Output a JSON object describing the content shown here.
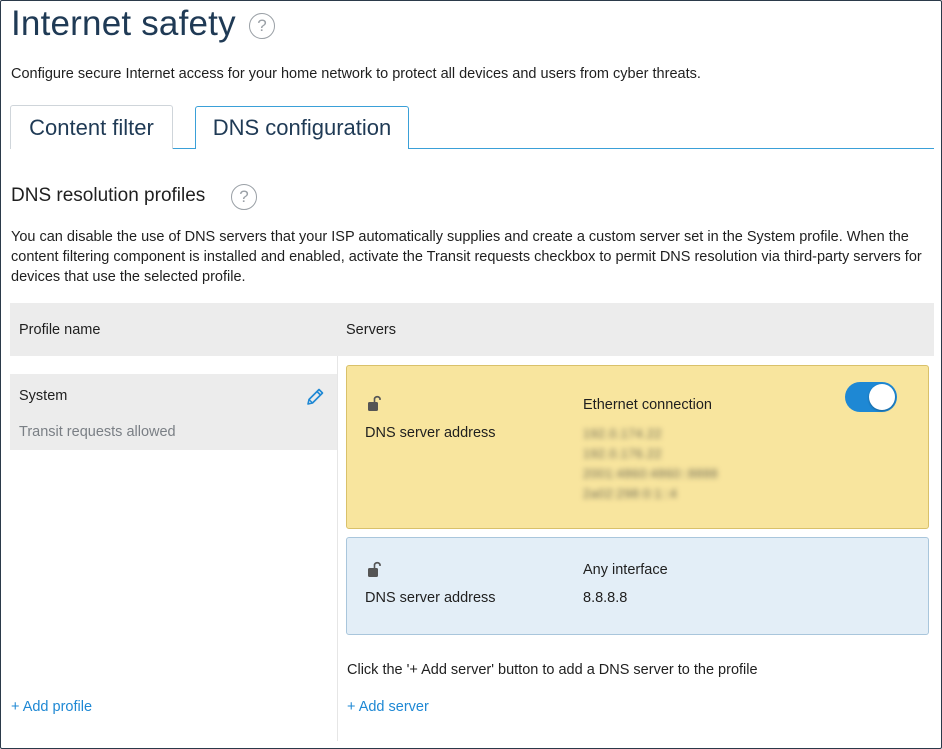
{
  "header": {
    "title": "Internet safety",
    "help_glyph": "?",
    "subtitle": "Configure secure Internet access for your home network to protect all devices and users from cyber threats."
  },
  "tabs": [
    {
      "label": "Content filter",
      "active": false
    },
    {
      "label": "DNS configuration",
      "active": true
    }
  ],
  "section": {
    "title": "DNS resolution profiles",
    "help_glyph": "?",
    "description": "You can disable the use of DNS servers that your ISP automatically supplies and create a custom server set in the System profile. When the content filtering component is installed and enabled, activate the Transit requests checkbox to permit DNS resolution via third-party servers for devices that use the selected profile."
  },
  "table": {
    "col_profile": "Profile name",
    "col_servers": "Servers"
  },
  "profile": {
    "name": "System",
    "status": "Transit requests allowed",
    "edit_icon": "pencil-icon"
  },
  "server_cards": [
    {
      "interface": "Ethernet connection",
      "label": "DNS server address",
      "addresses": [
        "192.0.174.22",
        "192.0.176.22",
        "2001:4860:4860::8888",
        "2a02:298:0:1::4"
      ],
      "addresses_obscured": true,
      "toggle_on": true,
      "lock_icon": "unlock-icon",
      "bg_color": "#f8e59e"
    },
    {
      "interface": "Any interface",
      "label": "DNS server address",
      "address": "8.8.8.8",
      "lock_icon": "unlock-icon",
      "bg_color": "#e3eef7"
    }
  ],
  "hint": "Click the '+ Add server' button to add a DNS server to the profile",
  "actions": {
    "add_profile": "+ Add profile",
    "add_server": "+ Add server"
  },
  "colors": {
    "accent": "#1e88d4",
    "title": "#1f3a55"
  }
}
